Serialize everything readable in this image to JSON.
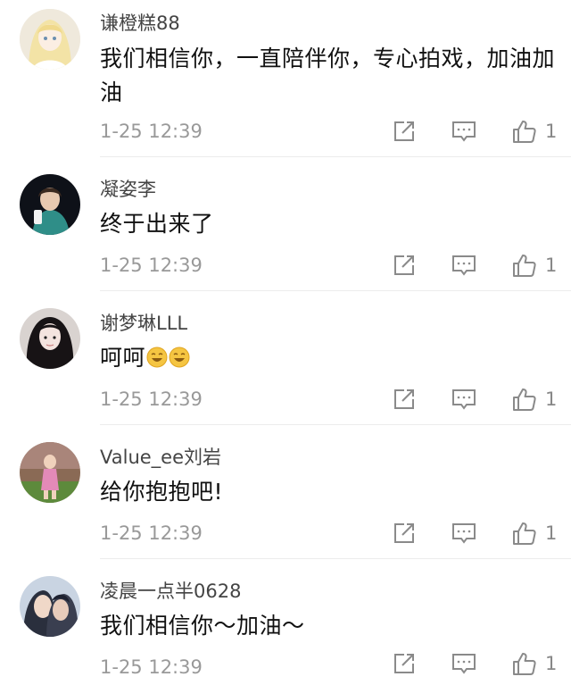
{
  "comments": [
    {
      "username": "谦橙糕88",
      "text": "我们相信你，一直陪伴你，专心拍戏，加油加油",
      "time": "1-25 12:39",
      "likes": "1",
      "avatar": "avatar-anime-girl"
    },
    {
      "username": "凝姿李",
      "text": "终于出来了",
      "time": "1-25 12:39",
      "likes": "1",
      "avatar": "avatar-girl-dark"
    },
    {
      "username": "谢梦琳LLL",
      "text": "呵呵",
      "emojis": [
        "emoji-laugh",
        "emoji-laugh"
      ],
      "time": "1-25 12:39",
      "likes": "1",
      "avatar": "avatar-girl-longhair"
    },
    {
      "username": "Value_ee刘岩",
      "text": "给你抱抱吧!",
      "time": "1-25 12:39",
      "likes": "1",
      "avatar": "avatar-child-outdoor"
    },
    {
      "username": "凌晨一点半0628",
      "text": "我们相信你～加油～",
      "time": "1-25 12:39",
      "likes": "1",
      "avatar": "avatar-couple"
    }
  ],
  "icons": {
    "share": "share-icon",
    "comment": "comment-icon",
    "like": "thumbs-up-icon"
  },
  "colors": {
    "username": "#444444",
    "text": "#111111",
    "meta": "#999999",
    "icon": "#8a8a8a",
    "divider": "#ececec"
  }
}
